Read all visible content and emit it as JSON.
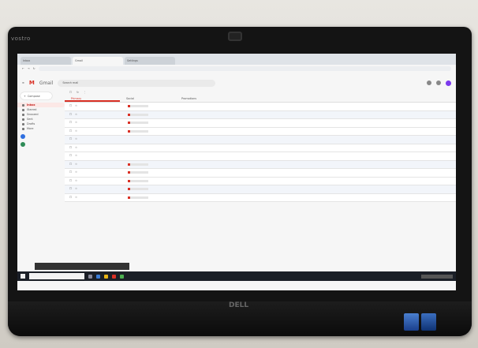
{
  "monitor": {
    "brand": "vostro",
    "logo": "DELL"
  },
  "browser": {
    "tabs": [
      {
        "label": "Inbox"
      },
      {
        "label": "Gmail"
      },
      {
        "label": "Settings"
      }
    ]
  },
  "gmail": {
    "app_name": "Gmail",
    "search_placeholder": "Search mail",
    "compose_label": "Compose",
    "sidebar_items": [
      {
        "label": "Inbox",
        "selected": true
      },
      {
        "label": "Starred"
      },
      {
        "label": "Snoozed"
      },
      {
        "label": "Sent"
      },
      {
        "label": "Drafts"
      },
      {
        "label": "More"
      }
    ],
    "categories": [
      {
        "label": "Primary",
        "selected": true
      },
      {
        "label": "Social"
      },
      {
        "label": "Promotions"
      }
    ],
    "emails": [
      {
        "attachment": true
      },
      {
        "attachment": true
      },
      {
        "attachment": true
      },
      {
        "attachment": true
      },
      {
        "attachment": false
      },
      {
        "attachment": false
      },
      {
        "attachment": false
      },
      {
        "attachment": true
      },
      {
        "attachment": true
      },
      {
        "attachment": true
      },
      {
        "attachment": true
      },
      {
        "attachment": true
      }
    ]
  },
  "colors": {
    "gmail_red": "#d93025",
    "taskbar": "#1b1f27",
    "bezel": "#141414"
  }
}
